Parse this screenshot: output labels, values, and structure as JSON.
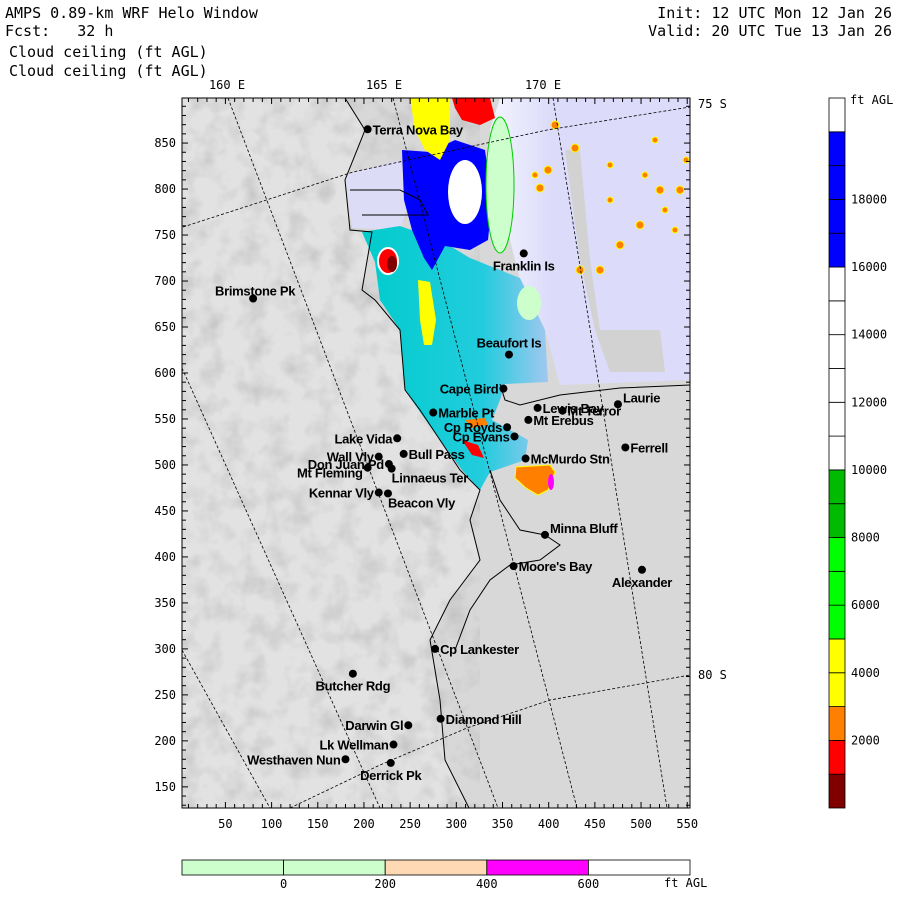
{
  "header": {
    "title": "AMPS 0.89-km WRF Helo Window",
    "forecast": "Fcst:   32 h",
    "init": "Init: 12 UTC Mon 12 Jan 26",
    "valid": "Valid: 20 UTC Tue 13 Jan 26",
    "field1": "Cloud ceiling (ft AGL)",
    "field2": "Cloud ceiling (ft AGL)"
  },
  "map": {
    "lon_labels": [
      "160 E",
      "165 E",
      "170 E"
    ],
    "lat_labels": [
      "75 S",
      "80 S"
    ],
    "x_ticks": [
      50,
      100,
      150,
      200,
      250,
      300,
      350,
      400,
      450,
      500,
      550
    ],
    "y_ticks": [
      150,
      200,
      250,
      300,
      350,
      400,
      450,
      500,
      550,
      600,
      650,
      700,
      750,
      800,
      850
    ],
    "x_range": [
      3,
      553
    ],
    "y_range": [
      127,
      899
    ],
    "stations": [
      {
        "name": "Terra Nova Bay",
        "x": 204,
        "y": 865
      },
      {
        "name": "Franklin Is",
        "x": 373,
        "y": 730
      },
      {
        "name": "Brimstone Pk",
        "x": 80,
        "y": 681
      },
      {
        "name": "Beaufort Is",
        "x": 357,
        "y": 620
      },
      {
        "name": "Cape Bird",
        "x": 351,
        "y": 583
      },
      {
        "name": "Marble Pt",
        "x": 275,
        "y": 557
      },
      {
        "name": "Lewis Bay",
        "x": 388,
        "y": 562
      },
      {
        "name": "Mt Terror",
        "x": 415,
        "y": 559
      },
      {
        "name": "Laurie",
        "x": 475,
        "y": 566
      },
      {
        "name": "Mt Erebus",
        "x": 378,
        "y": 549
      },
      {
        "name": "Cp Royds",
        "x": 355,
        "y": 541
      },
      {
        "name": "Cp Evans",
        "x": 363,
        "y": 531
      },
      {
        "name": "Ferrell",
        "x": 483,
        "y": 519
      },
      {
        "name": "McMurdo Stn",
        "x": 375,
        "y": 507
      },
      {
        "name": "Lake Vida",
        "x": 236,
        "y": 529
      },
      {
        "name": "Wall Vly",
        "x": 216,
        "y": 509
      },
      {
        "name": "Bull Pass",
        "x": 243,
        "y": 512
      },
      {
        "name": "Don Juan Pd",
        "x": 227,
        "y": 501
      },
      {
        "name": "Mt Fleming",
        "x": 204,
        "y": 497
      },
      {
        "name": "Linnaeus Ter",
        "x": 230,
        "y": 496
      },
      {
        "name": "Kennar Vly",
        "x": 216,
        "y": 470
      },
      {
        "name": "Beacon Vly",
        "x": 226,
        "y": 469
      },
      {
        "name": "Minna Bluff",
        "x": 396,
        "y": 424
      },
      {
        "name": "Moore's Bay",
        "x": 362,
        "y": 390
      },
      {
        "name": "Alexander",
        "x": 501,
        "y": 386
      },
      {
        "name": "Cp Lankester",
        "x": 277,
        "y": 300
      },
      {
        "name": "Butcher Rdg",
        "x": 188,
        "y": 273
      },
      {
        "name": "Diamond Hill",
        "x": 283,
        "y": 224
      },
      {
        "name": "Darwin Gl",
        "x": 248,
        "y": 217
      },
      {
        "name": "Lk Wellman",
        "x": 232,
        "y": 196
      },
      {
        "name": "Westhaven Nun",
        "x": 180,
        "y": 180
      },
      {
        "name": "Derrick Pk",
        "x": 229,
        "y": 176
      }
    ]
  },
  "ceiling_colorbar": {
    "unit": "ft AGL",
    "labels": [
      "2000",
      "4000",
      "6000",
      "8000",
      "10000",
      "12000",
      "14000",
      "16000",
      "18000"
    ],
    "bins": [
      "#800000",
      "#ff0000",
      "#ff8000",
      "#ffff00",
      "#ffff00",
      "#00ff00",
      "#00ff00",
      "#00ff00",
      "#00bb00",
      "#00bb00",
      "#ffffff",
      "#ffffff",
      "#ffffff",
      "#ffffff",
      "#ffffff",
      "#ffffff",
      "#0000ff",
      "#0000ff",
      "#0000ff",
      "#0000ff",
      "#ffffff"
    ]
  },
  "low_colorbar": {
    "unit": "ft AGL",
    "labels": [
      "0",
      "200",
      "400",
      "600"
    ],
    "bins": [
      "#ccffcc",
      "#ccffcc",
      "#ffd8b4",
      "#ff00ff",
      "#ffffff"
    ]
  }
}
